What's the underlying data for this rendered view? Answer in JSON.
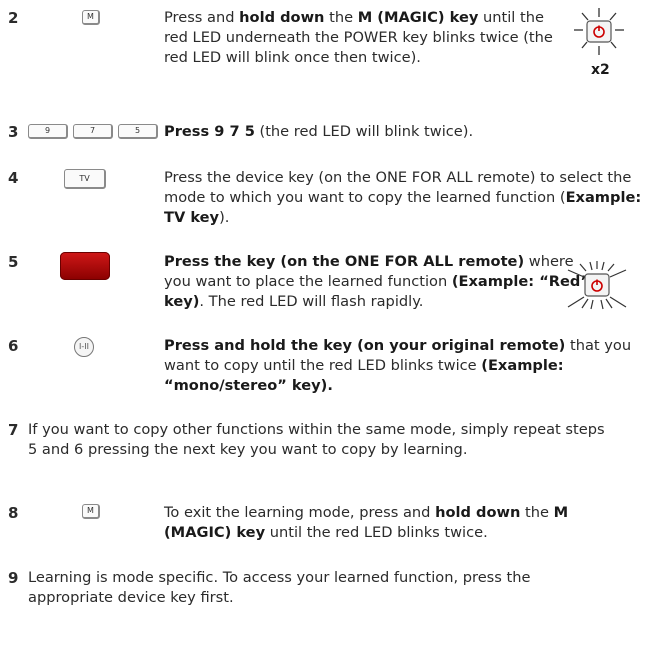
{
  "steps": [
    {
      "number": "2",
      "parts": [
        {
          "t": "Press and "
        },
        {
          "b": "hold down"
        },
        {
          "t": " the "
        },
        {
          "b": "M (MAGIC) key"
        },
        {
          "t": " until the red LED underneath the POWER key blinks twice (the red LED will blink once then twice)."
        }
      ]
    },
    {
      "number": "3",
      "parts": [
        {
          "b": "Press 9 7 5"
        },
        {
          "t": " (the red LED will blink twice)."
        }
      ]
    },
    {
      "number": "4",
      "parts": [
        {
          "t": "Press the device key (on the ONE FOR ALL remote) to select the mode to which you want to copy the learned function ("
        },
        {
          "b": "Example: TV key"
        },
        {
          "t": ")."
        }
      ]
    },
    {
      "number": "5",
      "parts": [
        {
          "b": "Press the key (on the ONE FOR ALL remote)"
        },
        {
          "t": " where you want to place the learned function "
        },
        {
          "b": "(Example: “Red” key)"
        },
        {
          "t": ". The red LED will flash rapidly."
        }
      ]
    },
    {
      "number": "6",
      "parts": [
        {
          "b": "Press and hold the key (on your original remote)"
        },
        {
          "t": " that you want to copy until the red LED blinks twice "
        },
        {
          "b": "(Example: “mono/stereo” key)."
        }
      ]
    },
    {
      "number": "7",
      "parts": [
        {
          "t": "If you want to copy other functions within the same mode, simply repeat steps 5 and 6 pressing the next key you want to copy by learning."
        }
      ]
    },
    {
      "number": "8",
      "parts": [
        {
          "t": "To exit the learning mode, press and "
        },
        {
          "b": "hold down"
        },
        {
          "t": " the "
        },
        {
          "b": "M (MAGIC) key"
        },
        {
          "t": " until the red LED blinks twice."
        }
      ]
    },
    {
      "number": "9",
      "parts": [
        {
          "t": "Learning is mode specific. To access your learned function, press the appropriate device key first."
        }
      ]
    }
  ],
  "keys": {
    "magic_key": "M",
    "digit_keys": [
      "9",
      "7",
      "5"
    ],
    "tv_key": "TV",
    "mono_stereo_key": "I-II"
  },
  "led_blink_count_label": "x2",
  "colors": {
    "text": "#2b2b2b",
    "red_key": "#b30f0f",
    "led_red": "#d01818"
  }
}
